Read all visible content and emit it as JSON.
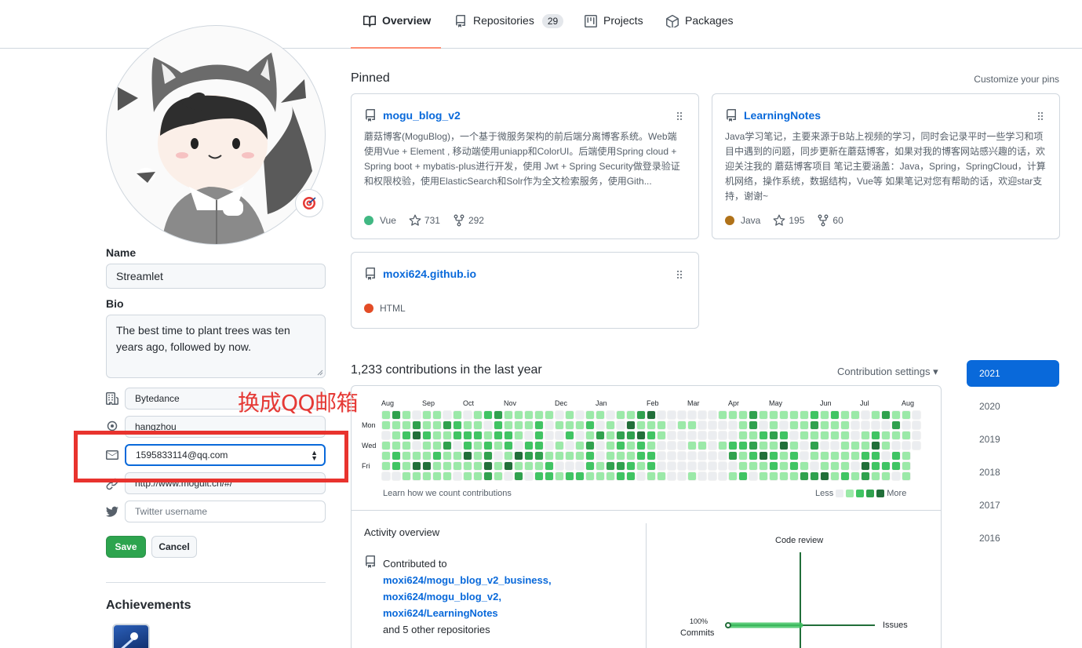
{
  "tabs": [
    {
      "label": "Overview",
      "icon": "book-icon",
      "active": true
    },
    {
      "label": "Repositories",
      "icon": "repo-icon",
      "count": "29"
    },
    {
      "label": "Projects",
      "icon": "project-icon"
    },
    {
      "label": "Packages",
      "icon": "package-icon"
    }
  ],
  "profile": {
    "name_label": "Name",
    "name_value": "Streamlet",
    "bio_label": "Bio",
    "bio_value": "The best time to plant trees was ten years ago, followed by now.",
    "company_value": "Bytedance",
    "location_value": "hangzhou",
    "email_value": "1595833114@qq.com",
    "website_value": "http://www.moguit.cn/#/",
    "twitter_placeholder": "Twitter username",
    "save_label": "Save",
    "cancel_label": "Cancel",
    "achievements_title": "Achievements"
  },
  "annotation": {
    "text": "换成QQ邮箱",
    "color": "#e8332e"
  },
  "pinned": {
    "title": "Pinned",
    "customize": "Customize your pins",
    "cards": [
      {
        "name": "mogu_blog_v2",
        "desc": "蘑菇博客(MoguBlog)，一个基于微服务架构的前后端分离博客系统。Web端使用Vue + Element , 移动端使用uniapp和ColorUI。后端使用Spring cloud + Spring boot + mybatis-plus进行开发，使用 Jwt + Spring Security做登录验证和权限校验，使用ElasticSearch和Solr作为全文检索服务，使用Gith...",
        "language": "Vue",
        "lang_color": "#41b883",
        "stars": "731",
        "forks": "292"
      },
      {
        "name": "LearningNotes",
        "desc": "Java学习笔记，主要来源于B站上视频的学习，同时会记录平时一些学习和项目中遇到的问题，同步更新在蘑菇博客，如果对我的博客网站感兴趣的话，欢迎关注我的 蘑菇博客项目 笔记主要涵盖：Java，Spring，SpringCloud，计算机网络，操作系统，数据结构，Vue等 如果笔记对您有帮助的话，欢迎star支持，谢谢~",
        "language": "Java",
        "lang_color": "#b07219",
        "stars": "195",
        "forks": "60"
      },
      {
        "name": "moxi624.github.io",
        "desc": "",
        "language": "HTML",
        "lang_color": "#e34c26"
      }
    ]
  },
  "contributions": {
    "title": "1,233 contributions in the last year",
    "settings_label": "Contribution settings ▾",
    "months": [
      "Aug",
      "Sep",
      "Oct",
      "Nov",
      "Dec",
      "Jan",
      "Feb",
      "Mar",
      "Apr",
      "May",
      "Jun",
      "Jul",
      "Aug"
    ],
    "days": [
      "Mon",
      "Wed",
      "Fri"
    ],
    "learn_label": "Learn how we count contributions",
    "less_label": "Less",
    "more_label": "More",
    "level_colors": [
      "#ebedf0",
      "#9be9a8",
      "#40c463",
      "#30a14e",
      "#216e39"
    ]
  },
  "activity": {
    "title": "Activity overview",
    "contributed_to_label": "Contributed to",
    "repos": [
      "moxi624/mogu_blog_v2_business,",
      "moxi624/mogu_blog_v2,",
      "moxi624/LearningNotes"
    ],
    "others": "and 5 other repositories",
    "code_review_label": "Code review",
    "issues_label": "Issues",
    "commits_percent": "100%",
    "commits_label": "Commits"
  },
  "years": [
    "2021",
    "2020",
    "2019",
    "2018",
    "2017",
    "2016"
  ],
  "active_year": "2021"
}
